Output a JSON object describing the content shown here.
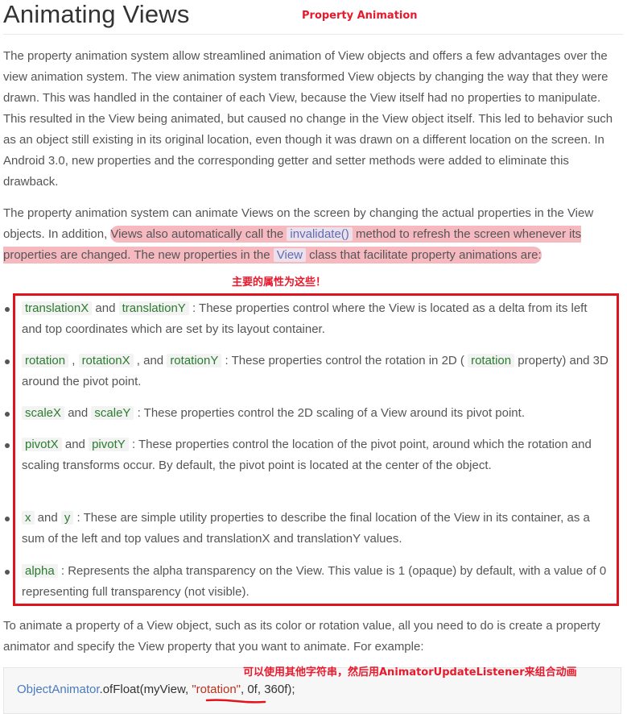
{
  "page": {
    "title": "Animating Views",
    "title_annotation": "Property Animation",
    "intro_paragraph": "The property animation system allow streamlined animation of View objects and offers a few advantages over the view animation system. The view animation system transformed View objects by changing the way that they were drawn. This was handled in the container of each View, because the View itself had no properties to manipulate. This resulted in the View being animated, but caused no change in the View object itself. This led to behavior such as an object still existing in its original location, even though it was drawn on a different location on the screen. In Android 3.0, new properties and the corresponding getter and setter methods were added to eliminate this drawback.",
    "second_paragraph": {
      "before": "The property animation system can animate Views on the screen by changing the actual properties in the View objects. In addition, ",
      "hl_1": "Views also automatically call the ",
      "code_invalidate": "invalidate()",
      "hl_2": " method to refresh the screen whenever its properties are changed. The new properties in the ",
      "code_view": "View",
      "hl_3": " class that facilitate property animations are:"
    },
    "main_properties_annotation": "主要的属性为这些！",
    "properties": {
      "translation": {
        "code_1": "translationX",
        "and": " and ",
        "code_2": "translationY",
        "desc": " : These properties control where the View is located as a delta from its left and top coordinates which are set by its layout container."
      },
      "rotation": {
        "code_1": "rotation",
        "sep_1": " , ",
        "code_2": "rotationX",
        "sep_2": " , and ",
        "code_3": "rotationY",
        "desc_1": " : These properties control the rotation in 2D ( ",
        "code_4": "rotation",
        "desc_2": " property) and 3D around the pivot point."
      },
      "scale": {
        "code_1": "scaleX",
        "and": " and ",
        "code_2": "scaleY",
        "desc": " : These properties control the 2D scaling of a View around its pivot point."
      },
      "pivot": {
        "code_1": "pivotX",
        "and": " and ",
        "code_2": "pivotY",
        "desc": " : These properties control the location of the pivot point, around which the rotation and scaling transforms occur. By default, the pivot point is located at the center of the object."
      },
      "xy": {
        "code_1": "x",
        "and": " and ",
        "code_2": "y",
        "desc": " : These are simple utility properties to describe the final location of the View in its container, as a sum of the left and top values and translationX and translationY values."
      },
      "alpha": {
        "code_1": "alpha",
        "desc": " : Represents the alpha transparency on the View. This value is 1 (opaque) by default, with a value of 0 representing full transparency (not visible)."
      }
    },
    "outro_paragraph": "To animate a property of a View object, such as its color or rotation value, all you need to do is create a property animator and specify the View property that you want to animate. For example:",
    "code_annotation": "可以使用其他字符串，然后用AnimatorUpdateListener来组合动画",
    "code_example": {
      "type": "ObjectAnimator",
      "dot_method": ".ofFloat(myView, ",
      "string_arg": "\"rotation\"",
      "comma_1": ", ",
      "num_1": "0f",
      "comma_2": ", ",
      "num_2": "360f",
      "end": ");"
    },
    "colors": {
      "annotation_red": "#e8192c",
      "highlight_pink": "#f0808c",
      "code_green": "#2a7c2e",
      "code_blue": "#5a6fb5"
    }
  }
}
